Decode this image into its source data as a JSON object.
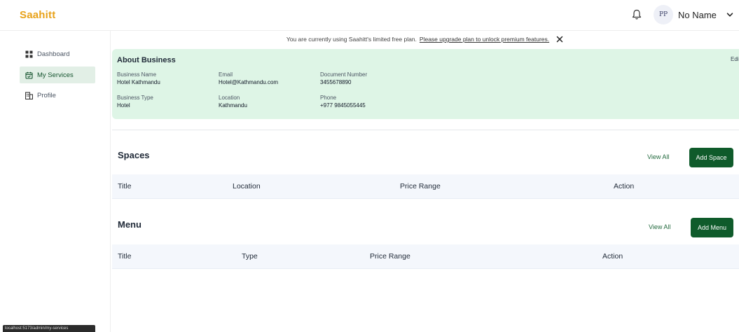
{
  "app": {
    "logo": "Saahitt"
  },
  "header": {
    "avatar_initials": "PP",
    "username": "No Name"
  },
  "sidebar": {
    "items": [
      {
        "label": "Dashboard",
        "icon": "grid-icon",
        "active": false
      },
      {
        "label": "My Services",
        "icon": "calendar-icon",
        "active": true
      },
      {
        "label": "Profile",
        "icon": "building-icon",
        "active": false
      }
    ]
  },
  "banner": {
    "text": "You are currently using Saahitt's limited free plan.",
    "link": "Please upgrade plan to unlock premium features."
  },
  "about": {
    "title": "About Business",
    "edit_label": "Edi",
    "fields": {
      "business_name": {
        "label": "Business Name",
        "value": "Hotel Kathmandu"
      },
      "email": {
        "label": "Email",
        "value": "Hotel@Kathmandu.com"
      },
      "document_number": {
        "label": "Document Number",
        "value": "3455678890"
      },
      "business_type": {
        "label": "Business Type",
        "value": "Hotel"
      },
      "location": {
        "label": "Location",
        "value": "Kathmandu"
      },
      "phone": {
        "label": "Phone",
        "value": "+977 9845055445"
      }
    }
  },
  "spaces": {
    "title": "Spaces",
    "view_all": "View All",
    "add_label": "Add Space",
    "columns": [
      "Title",
      "Location",
      "Price Range",
      "Action"
    ]
  },
  "menu": {
    "title": "Menu",
    "view_all": "View All",
    "add_label": "Add Menu",
    "columns": [
      "Title",
      "Type",
      "Price Range",
      "Action"
    ]
  },
  "status_url": "localhost:5173/admin/my-services",
  "colors": {
    "brand": "#e8a21a",
    "primary_green": "#0f5b2b",
    "about_bg": "#def5e6",
    "active_nav_bg": "#e2efe6"
  }
}
